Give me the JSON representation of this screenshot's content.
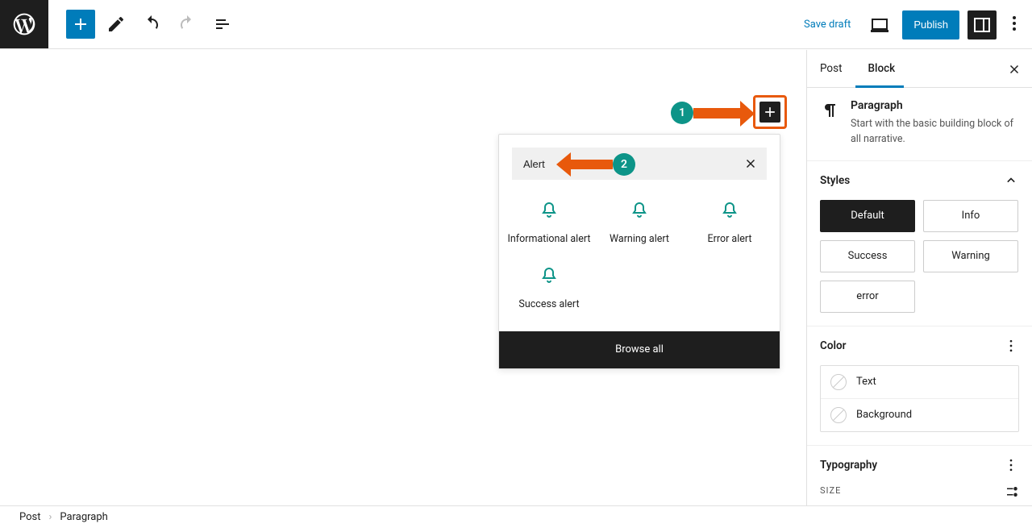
{
  "toolbar": {
    "save_draft": "Save draft",
    "publish": "Publish"
  },
  "inserter": {
    "search_value": "Alert",
    "blocks": [
      "Informational alert",
      "Warning alert",
      "Error alert",
      "Success alert"
    ],
    "browse_all": "Browse all"
  },
  "annotations": {
    "step1": "1",
    "step2": "2"
  },
  "sidebar": {
    "tabs": {
      "post": "Post",
      "block": "Block"
    },
    "block_name": "Paragraph",
    "block_desc": "Start with the basic building block of all narrative.",
    "panels": {
      "styles": "Styles",
      "color": "Color",
      "typography": "Typography"
    },
    "styles": [
      "Default",
      "Info",
      "Success",
      "Warning",
      "error"
    ],
    "colors": {
      "text": "Text",
      "background": "Background"
    },
    "size_label": "SIZE"
  },
  "breadcrumb": {
    "root": "Post",
    "current": "Paragraph"
  }
}
